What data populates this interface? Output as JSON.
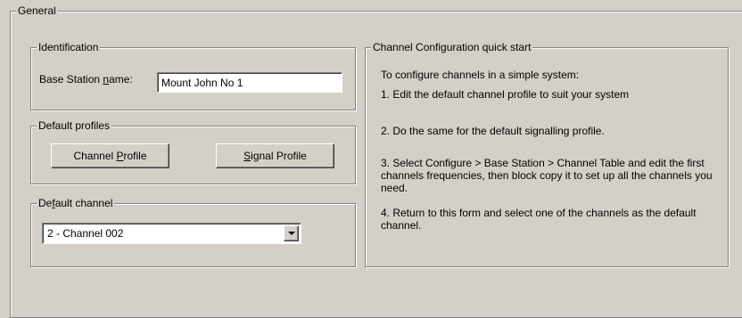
{
  "general": {
    "title": "General"
  },
  "identification": {
    "title": "Identification",
    "base_station_label_pre": "Base Station ",
    "base_station_label_u": "n",
    "base_station_label_post": "ame:",
    "base_station_value": "Mount John No 1"
  },
  "default_profiles": {
    "title": "Default profiles",
    "channel_btn_pre": "Channel ",
    "channel_btn_u": "P",
    "channel_btn_post": "rofile",
    "signal_btn_u": "S",
    "signal_btn_post": "ignal Profile"
  },
  "default_channel": {
    "title_pre": "De",
    "title_u": "f",
    "title_post": "ault channel",
    "selected": "2 - Channel 002"
  },
  "quick_start": {
    "title": "Channel Configuration quick start",
    "intro": "To configure channels in a simple system:",
    "step1": "1. Edit the default channel profile to suit your system",
    "step2": "2. Do the same for the default signalling profile.",
    "step3": "3. Select Configure > Base Station > Channel Table and edit the first channels frequencies, then block copy it to set up all the channels you need.",
    "step4": "4. Return to this form and select one of the channels as the default channel."
  }
}
